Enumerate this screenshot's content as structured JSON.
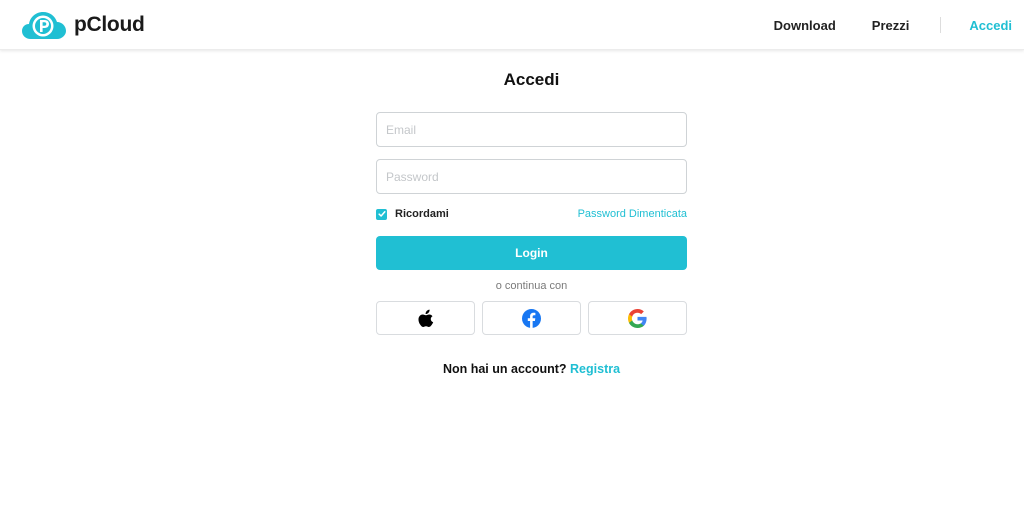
{
  "header": {
    "brand_name": "pCloud",
    "nav": {
      "download": "Download",
      "prezzi": "Prezzi",
      "accedi": "Accedi"
    },
    "logo_icon": "pcloud-logo-icon"
  },
  "login": {
    "title": "Accedi",
    "email_placeholder": "Email",
    "password_placeholder": "Password",
    "email_value": "",
    "password_value": "",
    "remember_label": "Ricordami",
    "remember_checked": true,
    "forgot_label": "Password Dimenticata",
    "login_button": "Login",
    "or_continue": "o continua con",
    "social": [
      {
        "name": "apple",
        "icon": "apple-icon"
      },
      {
        "name": "facebook",
        "icon": "facebook-icon"
      },
      {
        "name": "google",
        "icon": "google-icon"
      }
    ],
    "signup_prompt": "Non hai un account?",
    "signup_link": "Registra"
  },
  "colors": {
    "accent": "#20bfd3",
    "text": "#111111",
    "border": "#cfd3d6",
    "facebook": "#1877f2"
  }
}
